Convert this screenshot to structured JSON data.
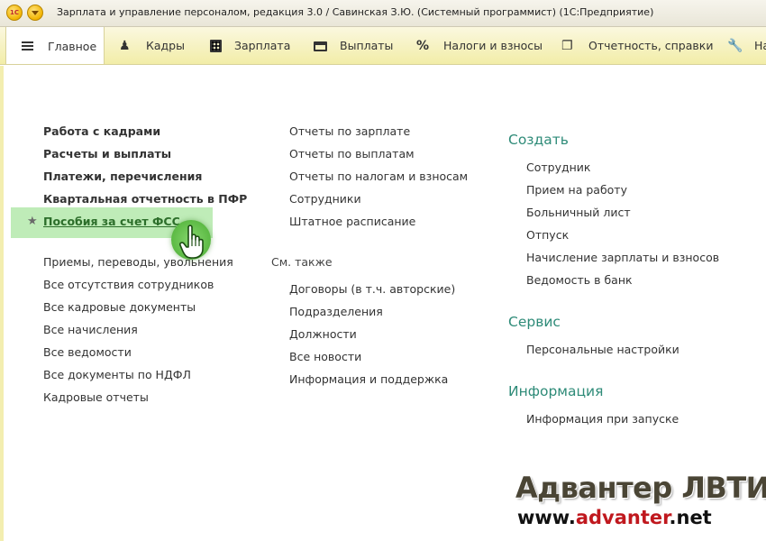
{
  "window": {
    "title": "Зарплата и управление персоналом, редакция 3.0 / Савинская З.Ю. (Системный программист)  (1С:Предприятие)",
    "logo_text": "1C"
  },
  "sections": [
    {
      "label": "Главное",
      "icon": "menu-icon",
      "active": true
    },
    {
      "label": "Кадры",
      "icon": "users-icon"
    },
    {
      "label": "Зарплата",
      "icon": "calculator-icon"
    },
    {
      "label": "Выплаты",
      "icon": "wallet-icon"
    },
    {
      "label": "Налоги и взносы",
      "icon": "percent-icon"
    },
    {
      "label": "Отчетность, справки",
      "icon": "document-icon"
    },
    {
      "label": "На",
      "icon": "wrench-icon"
    }
  ],
  "column1": {
    "bold_links": [
      "Работа с кадрами",
      "Расчеты и выплаты",
      "Платежи, перечисления",
      "Квартальная отчетность в ПФР"
    ],
    "highlighted_link": "Пособия за счет ФСС",
    "links": [
      "Приемы, переводы, увольнения",
      "Все отсутствия сотрудников",
      "Все кадровые документы",
      "Все начисления",
      "Все ведомости",
      "Все документы по НДФЛ",
      "Кадровые отчеты"
    ]
  },
  "column2": {
    "links": [
      "Отчеты по зарплате",
      "Отчеты по выплатам",
      "Отчеты по налогам и взносам",
      "Сотрудники",
      "Штатное расписание"
    ],
    "see_also_label": "См. также",
    "see_also_links": [
      "Договоры (в т.ч. авторские)",
      "Подразделения",
      "Должности",
      "Все новости",
      "Информация и поддержка"
    ]
  },
  "column3": {
    "create": {
      "title": "Создать",
      "links": [
        "Сотрудник",
        "Прием на работу",
        "Больничный лист",
        "Отпуск",
        "Начисление зарплаты и взносов",
        "Ведомость в банк"
      ]
    },
    "service": {
      "title": "Сервис",
      "links": [
        "Персональные настройки"
      ]
    },
    "info": {
      "title": "Информация",
      "links": [
        "Информация при запуске"
      ]
    }
  },
  "watermark": {
    "line1": "Адвантер ЛВТИ",
    "url_prefix": "www.",
    "url_mid": "advanter",
    "url_suffix": ".net"
  },
  "colors": {
    "group_heading": "#2e8b78",
    "highlight": "#a9e6a0",
    "section_bar": "#f2eda8"
  }
}
